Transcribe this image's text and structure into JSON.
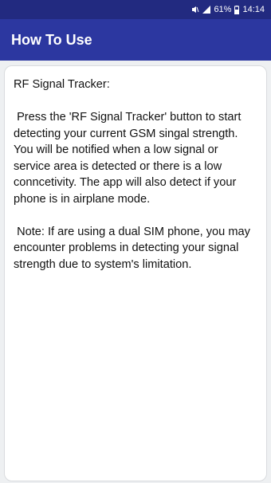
{
  "status_bar": {
    "battery_percent": "61%",
    "time": "14:14",
    "icons": [
      "mute-icon",
      "signal-icon",
      "battery-icon"
    ]
  },
  "app_bar": {
    "title": "How To Use"
  },
  "card": {
    "text": "RF Signal Tracker:\n\n Press the 'RF Signal Tracker' button to start detecting your current GSM singal strength. You will be notified when a low signal or service area is detected or there is a low conncetivity. The app will also detect if your phone is in airplane mode.\n\n Note: If are using a dual SIM phone, you may encounter problems in detecting your signal strength due to system's limitation."
  },
  "colors": {
    "status_bar": "#222a80",
    "app_bar": "#2c37a0",
    "background": "#eef0f2"
  }
}
